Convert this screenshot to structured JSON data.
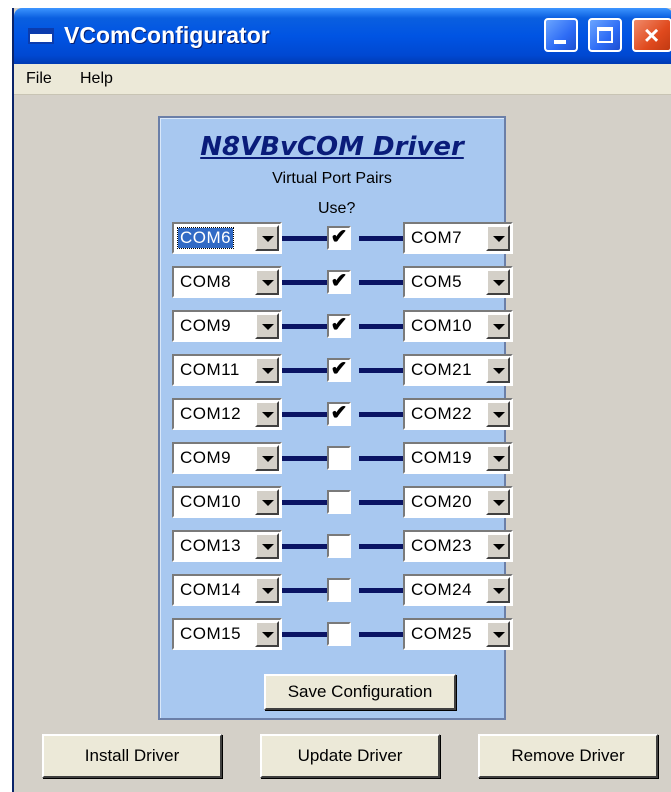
{
  "window": {
    "title": "VComConfigurator"
  },
  "menu": {
    "file": "File",
    "help": "Help"
  },
  "panel": {
    "title": "N8VBvCOM Driver",
    "subtitle": "Virtual Port Pairs",
    "use_label": "Use?",
    "check_mark": "✔",
    "save_label": "Save Configuration"
  },
  "rows": [
    {
      "left": "COM6",
      "right": "COM7",
      "checked": true
    },
    {
      "left": "COM8",
      "right": "COM5",
      "checked": true
    },
    {
      "left": "COM9",
      "right": "COM10",
      "checked": true
    },
    {
      "left": "COM11",
      "right": "COM21",
      "checked": true
    },
    {
      "left": "COM12",
      "right": "COM22",
      "checked": true
    },
    {
      "left": "COM9",
      "right": "COM19",
      "checked": false
    },
    {
      "left": "COM10",
      "right": "COM20",
      "checked": false
    },
    {
      "left": "COM13",
      "right": "COM23",
      "checked": false
    },
    {
      "left": "COM14",
      "right": "COM24",
      "checked": false
    },
    {
      "left": "COM15",
      "right": "COM25",
      "checked": false
    }
  ],
  "buttons": {
    "install": "Install Driver",
    "update": "Update Driver",
    "remove": "Remove Driver"
  }
}
